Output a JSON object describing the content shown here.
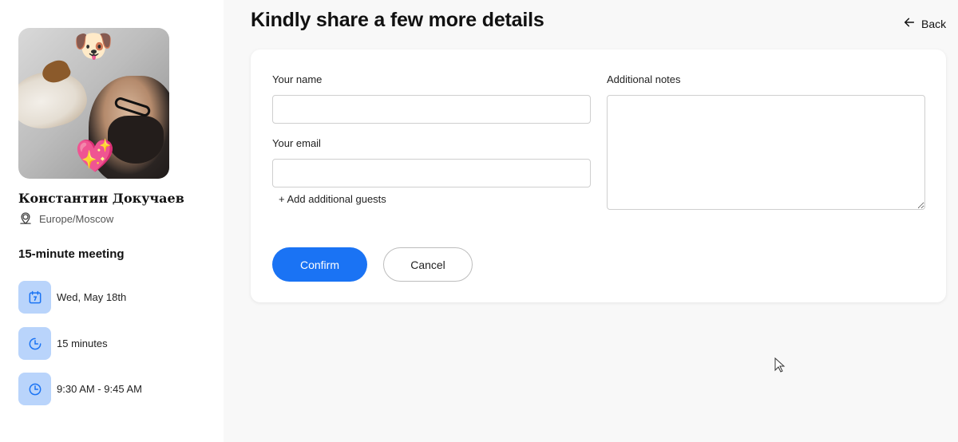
{
  "sidebar": {
    "host_name": "Константин Докучаев",
    "timezone": "Europe/Moscow",
    "meeting_title": "15-minute meeting",
    "details": [
      {
        "icon": "calendar-icon",
        "label": "Wed, May 18th"
      },
      {
        "icon": "clock-icon",
        "label": "15 minutes"
      },
      {
        "icon": "clock-icon",
        "label": "9:30 AM - 9:45 AM"
      }
    ],
    "avatar_emojis": {
      "top": "🐶",
      "bottom": "💖"
    }
  },
  "header": {
    "title": "Kindly share a few more details",
    "back_label": "Back"
  },
  "form": {
    "name_label": "Your name",
    "name_value": "",
    "email_label": "Your email",
    "email_value": "",
    "add_guests_label": "+ Add additional guests",
    "notes_label": "Additional notes",
    "notes_value": "",
    "confirm_label": "Confirm",
    "cancel_label": "Cancel"
  },
  "colors": {
    "accent": "#1a73f4",
    "icon_bg": "#b9d4fb",
    "icon_fg": "#1a73f4"
  }
}
